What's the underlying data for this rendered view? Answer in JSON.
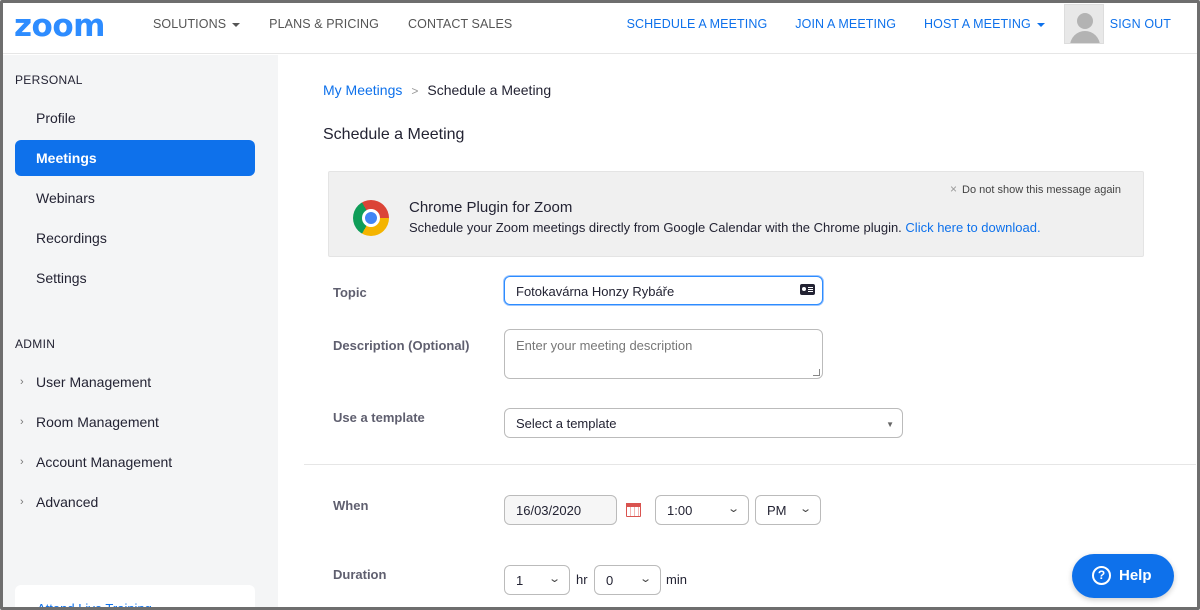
{
  "header": {
    "logo": "zoom",
    "nav_left": [
      {
        "label": "SOLUTIONS",
        "has_caret": true
      },
      {
        "label": "PLANS & PRICING"
      },
      {
        "label": "CONTACT SALES"
      }
    ],
    "nav_right": [
      {
        "label": "SCHEDULE A MEETING"
      },
      {
        "label": "JOIN A MEETING"
      },
      {
        "label": "HOST A MEETING",
        "has_caret": true
      }
    ],
    "sign_out": "SIGN OUT"
  },
  "sidebar": {
    "personal_heading": "PERSONAL",
    "personal_items": [
      "Profile",
      "Meetings",
      "Webinars",
      "Recordings",
      "Settings"
    ],
    "active_item": "Meetings",
    "admin_heading": "ADMIN",
    "admin_items": [
      "User Management",
      "Room Management",
      "Account Management",
      "Advanced"
    ],
    "bottom_card_text": "Attend Live Training"
  },
  "breadcrumb": {
    "parent": "My Meetings",
    "separator": ">",
    "current": "Schedule a Meeting"
  },
  "page_title": "Schedule a Meeting",
  "plugin_banner": {
    "title": "Chrome Plugin for Zoom",
    "description": "Schedule your Zoom meetings directly from Google Calendar with the Chrome plugin.",
    "link": "Click here to download.",
    "dismiss": "Do not show this message again",
    "dismiss_icon": "×"
  },
  "form": {
    "topic": {
      "label": "Topic",
      "value": "Fotokavárna Honzy Rybáře"
    },
    "description": {
      "label": "Description (Optional)",
      "placeholder": "Enter your meeting description"
    },
    "template": {
      "label": "Use a template",
      "value": "Select a template"
    },
    "when": {
      "label": "When",
      "date": "16/03/2020",
      "time": "1:00",
      "ampm": "PM"
    },
    "duration": {
      "label": "Duration",
      "hours": "1",
      "hours_unit": "hr",
      "minutes": "0",
      "minutes_unit": "min"
    }
  },
  "help_button": "Help",
  "colors": {
    "brand_blue": "#2D8CFF",
    "link_blue": "#0E71EB",
    "sidebar_bg": "#f4f5f6"
  }
}
